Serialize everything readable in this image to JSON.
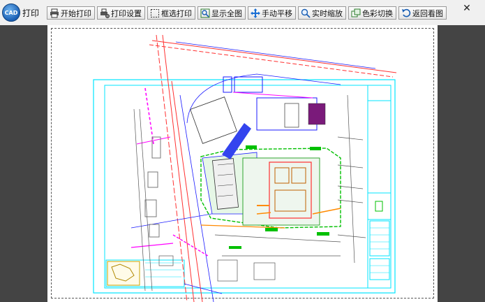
{
  "window": {
    "title": "打印",
    "logo_text": "CAD"
  },
  "toolbar": {
    "buttons": [
      {
        "label": "开始打印",
        "icon": "printer-icon"
      },
      {
        "label": "打印设置",
        "icon": "print-settings-icon"
      },
      {
        "label": "框选打印",
        "icon": "box-select-icon"
      },
      {
        "label": "显示全图",
        "icon": "fit-view-icon"
      },
      {
        "label": "手动平移",
        "icon": "pan-icon"
      },
      {
        "label": "实时缩放",
        "icon": "zoom-icon"
      },
      {
        "label": "色彩切换",
        "icon": "color-switch-icon"
      },
      {
        "label": "返回看图",
        "icon": "back-icon"
      }
    ]
  },
  "close_icon": "close-icon",
  "colors": {
    "workspace": "#444444",
    "paper": "#ffffff",
    "cad_cyan": "#00e5ff",
    "cad_red": "#ff3030",
    "cad_blue": "#1a1aff",
    "cad_green": "#00c000",
    "cad_magenta": "#ff00ff"
  }
}
